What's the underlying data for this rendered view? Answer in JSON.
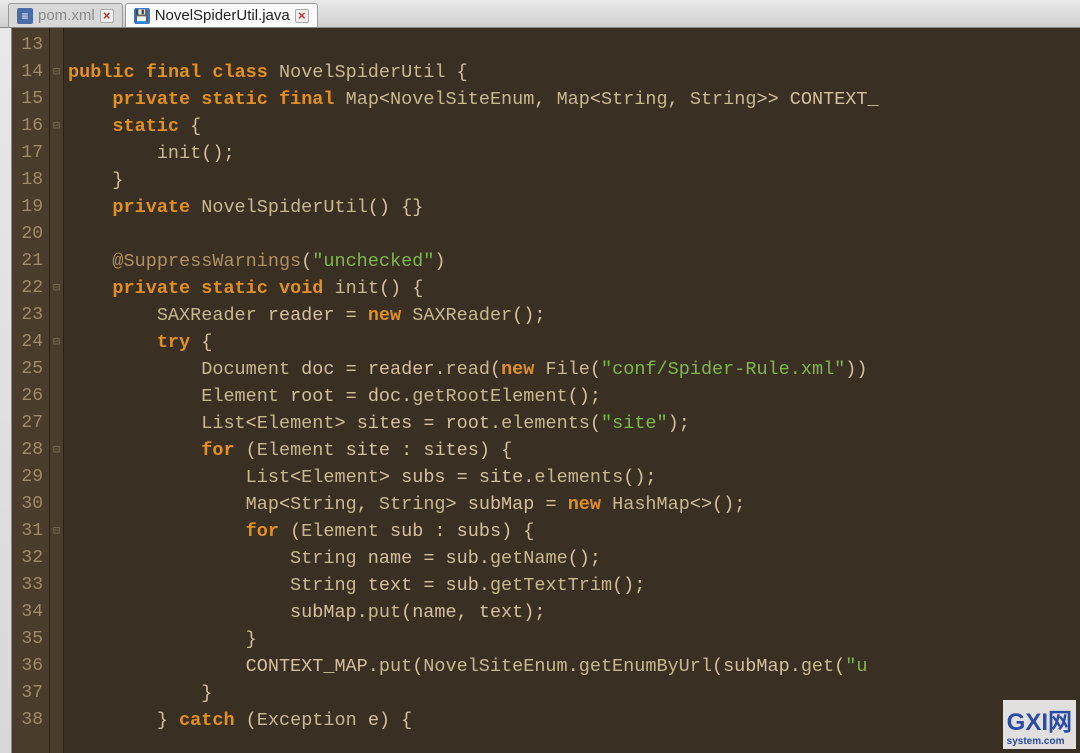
{
  "tabs": [
    {
      "label": "pom.xml",
      "icon": "xml",
      "active": false
    },
    {
      "label": "NovelSpiderUtil.java",
      "icon": "java",
      "active": true
    }
  ],
  "watermark": {
    "main": "GXI网",
    "sub": "system.com"
  },
  "line_start": 13,
  "line_end": 38,
  "fold_markers": {
    "14": "⊟",
    "16": "⊟",
    "22": "⊟",
    "24": "⊟",
    "28": "⊟",
    "31": "⊟"
  },
  "code_lines": {
    "13": [],
    "14": [
      [
        "kw",
        "public"
      ],
      [
        "sp",
        " "
      ],
      [
        "kw",
        "final"
      ],
      [
        "sp",
        " "
      ],
      [
        "kw",
        "class"
      ],
      [
        "sp",
        " "
      ],
      [
        "type",
        "NovelSpiderUtil"
      ],
      [
        "sp",
        " "
      ],
      [
        "punct",
        "{"
      ]
    ],
    "15": [
      [
        "sp",
        "    "
      ],
      [
        "kw",
        "private"
      ],
      [
        "sp",
        " "
      ],
      [
        "kw",
        "static"
      ],
      [
        "sp",
        " "
      ],
      [
        "kw",
        "final"
      ],
      [
        "sp",
        " "
      ],
      [
        "type",
        "Map"
      ],
      [
        "punct",
        "<"
      ],
      [
        "type",
        "NovelSiteEnum"
      ],
      [
        "punct",
        ", "
      ],
      [
        "type",
        "Map"
      ],
      [
        "punct",
        "<"
      ],
      [
        "type",
        "String"
      ],
      [
        "punct",
        ", "
      ],
      [
        "type",
        "String"
      ],
      [
        "punct",
        ">>"
      ],
      [
        "sp",
        " "
      ],
      [
        "ident",
        "CONTEXT_"
      ]
    ],
    "16": [
      [
        "sp",
        "    "
      ],
      [
        "kw",
        "static"
      ],
      [
        "sp",
        " "
      ],
      [
        "punct",
        "{"
      ]
    ],
    "17": [
      [
        "sp",
        "        "
      ],
      [
        "fn",
        "init"
      ],
      [
        "punct",
        "();"
      ]
    ],
    "18": [
      [
        "sp",
        "    "
      ],
      [
        "punct",
        "}"
      ]
    ],
    "19": [
      [
        "sp",
        "    "
      ],
      [
        "kw",
        "private"
      ],
      [
        "sp",
        " "
      ],
      [
        "type",
        "NovelSpiderUtil"
      ],
      [
        "punct",
        "() {}"
      ]
    ],
    "20": [],
    "21": [
      [
        "sp",
        "    "
      ],
      [
        "ann",
        "@SuppressWarnings"
      ],
      [
        "annparen",
        "("
      ],
      [
        "str",
        "\"unchecked\""
      ],
      [
        "annparen",
        ")"
      ]
    ],
    "22": [
      [
        "sp",
        "    "
      ],
      [
        "kw",
        "private"
      ],
      [
        "sp",
        " "
      ],
      [
        "kw",
        "static"
      ],
      [
        "sp",
        " "
      ],
      [
        "kw",
        "void"
      ],
      [
        "sp",
        " "
      ],
      [
        "fn",
        "init"
      ],
      [
        "punct",
        "() {"
      ]
    ],
    "23": [
      [
        "sp",
        "        "
      ],
      [
        "type",
        "SAXReader"
      ],
      [
        "sp",
        " "
      ],
      [
        "ident",
        "reader"
      ],
      [
        "sp",
        " "
      ],
      [
        "op",
        "="
      ],
      [
        "sp",
        " "
      ],
      [
        "kw",
        "new"
      ],
      [
        "sp",
        " "
      ],
      [
        "type",
        "SAXReader"
      ],
      [
        "punct",
        "();"
      ]
    ],
    "24": [
      [
        "sp",
        "        "
      ],
      [
        "kw",
        "try"
      ],
      [
        "sp",
        " "
      ],
      [
        "punct",
        "{"
      ]
    ],
    "25": [
      [
        "sp",
        "            "
      ],
      [
        "type",
        "Document"
      ],
      [
        "sp",
        " "
      ],
      [
        "ident",
        "doc"
      ],
      [
        "sp",
        " "
      ],
      [
        "op",
        "="
      ],
      [
        "sp",
        " "
      ],
      [
        "ident",
        "reader"
      ],
      [
        "punct",
        "."
      ],
      [
        "method",
        "read"
      ],
      [
        "punct",
        "("
      ],
      [
        "kw",
        "new"
      ],
      [
        "sp",
        " "
      ],
      [
        "type",
        "File"
      ],
      [
        "punct",
        "("
      ],
      [
        "str",
        "\"conf/Spider-Rule.xml\""
      ],
      [
        "punct",
        "))"
      ]
    ],
    "26": [
      [
        "sp",
        "            "
      ],
      [
        "type",
        "Element"
      ],
      [
        "sp",
        " "
      ],
      [
        "ident",
        "root"
      ],
      [
        "sp",
        " "
      ],
      [
        "op",
        "="
      ],
      [
        "sp",
        " "
      ],
      [
        "ident",
        "doc"
      ],
      [
        "punct",
        "."
      ],
      [
        "method",
        "getRootElement"
      ],
      [
        "punct",
        "();"
      ]
    ],
    "27": [
      [
        "sp",
        "            "
      ],
      [
        "type",
        "List"
      ],
      [
        "punct",
        "<"
      ],
      [
        "type",
        "Element"
      ],
      [
        "punct",
        "> "
      ],
      [
        "ident",
        "sites"
      ],
      [
        "sp",
        " "
      ],
      [
        "op",
        "="
      ],
      [
        "sp",
        " "
      ],
      [
        "ident",
        "root"
      ],
      [
        "punct",
        "."
      ],
      [
        "method",
        "elements"
      ],
      [
        "punct",
        "("
      ],
      [
        "str",
        "\"site\""
      ],
      [
        "punct",
        ");"
      ]
    ],
    "28": [
      [
        "sp",
        "            "
      ],
      [
        "kw",
        "for"
      ],
      [
        "sp",
        " "
      ],
      [
        "punct",
        "("
      ],
      [
        "type",
        "Element"
      ],
      [
        "sp",
        " "
      ],
      [
        "ident",
        "site"
      ],
      [
        "sp",
        " "
      ],
      [
        "op",
        ":"
      ],
      [
        "sp",
        " "
      ],
      [
        "ident",
        "sites"
      ],
      [
        "punct",
        ") {"
      ]
    ],
    "29": [
      [
        "sp",
        "                "
      ],
      [
        "type",
        "List"
      ],
      [
        "punct",
        "<"
      ],
      [
        "type",
        "Element"
      ],
      [
        "punct",
        "> "
      ],
      [
        "ident",
        "subs"
      ],
      [
        "sp",
        " "
      ],
      [
        "op",
        "="
      ],
      [
        "sp",
        " "
      ],
      [
        "ident",
        "site"
      ],
      [
        "punct",
        "."
      ],
      [
        "method",
        "elements"
      ],
      [
        "punct",
        "();"
      ]
    ],
    "30": [
      [
        "sp",
        "                "
      ],
      [
        "type",
        "Map"
      ],
      [
        "punct",
        "<"
      ],
      [
        "type",
        "String"
      ],
      [
        "punct",
        ", "
      ],
      [
        "type",
        "String"
      ],
      [
        "punct",
        "> "
      ],
      [
        "ident",
        "subMap"
      ],
      [
        "sp",
        " "
      ],
      [
        "op",
        "="
      ],
      [
        "sp",
        " "
      ],
      [
        "kw",
        "new"
      ],
      [
        "sp",
        " "
      ],
      [
        "type",
        "HashMap"
      ],
      [
        "punct",
        "<>();"
      ]
    ],
    "31": [
      [
        "sp",
        "                "
      ],
      [
        "kw",
        "for"
      ],
      [
        "sp",
        " "
      ],
      [
        "punct",
        "("
      ],
      [
        "type",
        "Element"
      ],
      [
        "sp",
        " "
      ],
      [
        "ident",
        "sub"
      ],
      [
        "sp",
        " "
      ],
      [
        "op",
        ":"
      ],
      [
        "sp",
        " "
      ],
      [
        "ident",
        "subs"
      ],
      [
        "punct",
        ") {"
      ]
    ],
    "32": [
      [
        "sp",
        "                    "
      ],
      [
        "type",
        "String"
      ],
      [
        "sp",
        " "
      ],
      [
        "ident",
        "name"
      ],
      [
        "sp",
        " "
      ],
      [
        "op",
        "="
      ],
      [
        "sp",
        " "
      ],
      [
        "ident",
        "sub"
      ],
      [
        "punct",
        "."
      ],
      [
        "method",
        "getName"
      ],
      [
        "punct",
        "();"
      ]
    ],
    "33": [
      [
        "sp",
        "                    "
      ],
      [
        "type",
        "String"
      ],
      [
        "sp",
        " "
      ],
      [
        "ident",
        "text"
      ],
      [
        "sp",
        " "
      ],
      [
        "op",
        "="
      ],
      [
        "sp",
        " "
      ],
      [
        "ident",
        "sub"
      ],
      [
        "punct",
        "."
      ],
      [
        "method",
        "getTextTrim"
      ],
      [
        "punct",
        "();"
      ]
    ],
    "34": [
      [
        "sp",
        "                    "
      ],
      [
        "ident",
        "subMap"
      ],
      [
        "punct",
        "."
      ],
      [
        "method",
        "put"
      ],
      [
        "punct",
        "("
      ],
      [
        "ident",
        "name"
      ],
      [
        "punct",
        ", "
      ],
      [
        "ident",
        "text"
      ],
      [
        "punct",
        ");"
      ]
    ],
    "35": [
      [
        "sp",
        "                "
      ],
      [
        "punct",
        "}"
      ]
    ],
    "36": [
      [
        "sp",
        "                "
      ],
      [
        "ident",
        "CONTEXT_MAP"
      ],
      [
        "punct",
        "."
      ],
      [
        "method",
        "put"
      ],
      [
        "punct",
        "("
      ],
      [
        "type",
        "NovelSiteEnum"
      ],
      [
        "punct",
        "."
      ],
      [
        "method",
        "getEnumByUrl"
      ],
      [
        "punct",
        "("
      ],
      [
        "ident",
        "subMap"
      ],
      [
        "punct",
        "."
      ],
      [
        "method",
        "get"
      ],
      [
        "punct",
        "("
      ],
      [
        "str",
        "\"u"
      ]
    ],
    "37": [
      [
        "sp",
        "            "
      ],
      [
        "punct",
        "}"
      ]
    ],
    "38": [
      [
        "sp",
        "        "
      ],
      [
        "punct",
        "}"
      ],
      [
        "sp",
        " "
      ],
      [
        "kw",
        "catch"
      ],
      [
        "sp",
        " "
      ],
      [
        "punct",
        "("
      ],
      [
        "type",
        "Exception"
      ],
      [
        "sp",
        " "
      ],
      [
        "ident",
        "e"
      ],
      [
        "punct",
        ") {"
      ]
    ]
  }
}
